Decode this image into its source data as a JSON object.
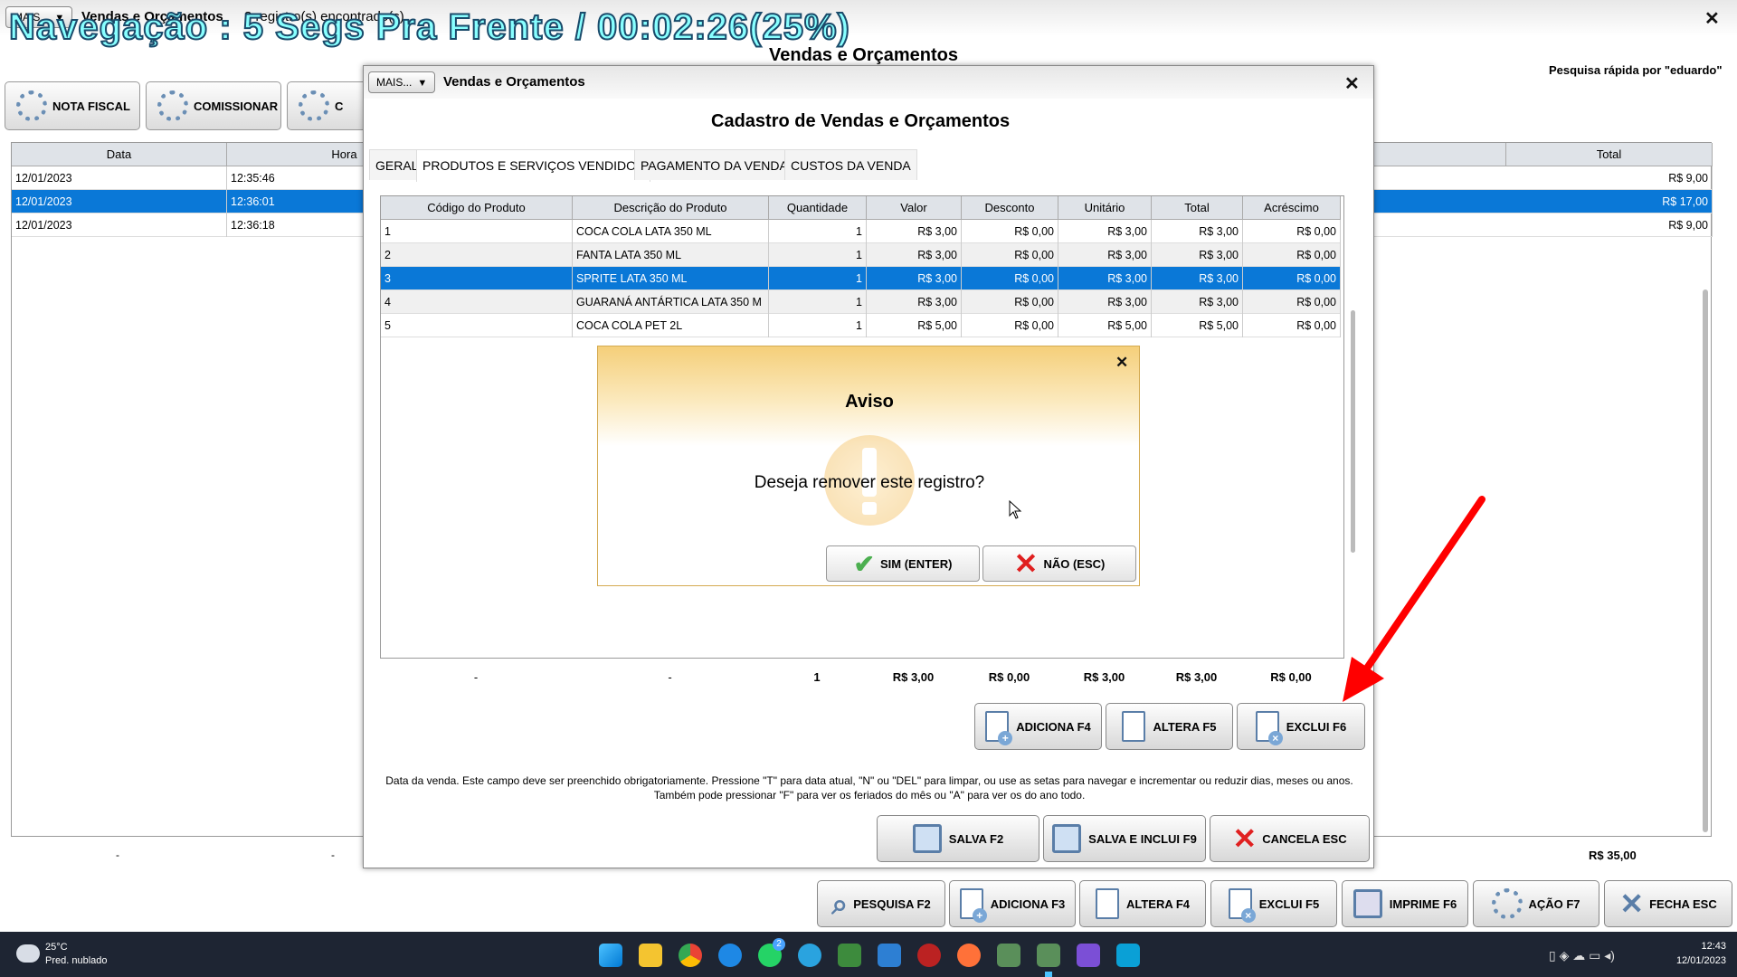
{
  "main": {
    "mais_label": "MAIS...",
    "title": "Vendas e Orçamentos",
    "record_count": "3 registro(s) encontrado(s)",
    "heading": "Vendas e Orçamentos",
    "quick_search": "Pesquisa rápida por \"eduardo\"",
    "toolbar": {
      "nota_fiscal": "NOTA FISCAL",
      "comissionar": "COMISSIONAR",
      "partial": "C"
    },
    "columns": {
      "data": "Data",
      "hora": "Hora",
      "total": "Total"
    },
    "rows": [
      {
        "data": "12/01/2023",
        "hora": "12:35:46",
        "total": "R$ 9,00"
      },
      {
        "data": "12/01/2023",
        "hora": "12:36:01",
        "total": "R$ 17,00"
      },
      {
        "data": "12/01/2023",
        "hora": "12:36:18",
        "total": "R$ 9,00"
      }
    ],
    "footer": {
      "data": "-",
      "hora": "-",
      "total": "R$ 35,00"
    },
    "buttons": {
      "pesquisa": "PESQUISA F2",
      "adiciona": "ADICIONA F3",
      "altera": "ALTERA F4",
      "exclui": "EXCLUI F5",
      "imprime": "IMPRIME F6",
      "acao": "AÇÃO F7",
      "fecha": "FECHA ESC"
    }
  },
  "overlay": {
    "text": "Navegação : 5 Segs Pra Frente / 00:02:26(25%)"
  },
  "dialog": {
    "mais_label": "MAIS...",
    "title": "Vendas e Orçamentos",
    "heading": "Cadastro de Vendas e Orçamentos",
    "tabs": [
      "GERAL",
      "PRODUTOS E SERVIÇOS VENDIDOS",
      "PAGAMENTO DA VENDA",
      "CUSTOS DA VENDA"
    ],
    "columns": [
      "Código do Produto",
      "Descrição do Produto",
      "Quantidade",
      "Valor",
      "Desconto",
      "Unitário",
      "Total",
      "Acréscimo"
    ],
    "rows": [
      [
        "1",
        "COCA COLA LATA 350 ML",
        "1",
        "R$ 3,00",
        "R$ 0,00",
        "R$ 3,00",
        "R$ 3,00",
        "R$ 0,00"
      ],
      [
        "2",
        "FANTA LATA 350 ML",
        "1",
        "R$ 3,00",
        "R$ 0,00",
        "R$ 3,00",
        "R$ 3,00",
        "R$ 0,00"
      ],
      [
        "3",
        "SPRITE LATA 350 ML",
        "1",
        "R$ 3,00",
        "R$ 0,00",
        "R$ 3,00",
        "R$ 3,00",
        "R$ 0,00"
      ],
      [
        "4",
        "GUARANÁ ANTÁRTICA LATA 350 M",
        "1",
        "R$ 3,00",
        "R$ 0,00",
        "R$ 3,00",
        "R$ 3,00",
        "R$ 0,00"
      ],
      [
        "5",
        "COCA COLA PET 2L",
        "1",
        "R$ 5,00",
        "R$ 0,00",
        "R$ 5,00",
        "R$ 5,00",
        "R$ 0,00"
      ]
    ],
    "footer": [
      "-",
      "-",
      "1",
      "R$ 3,00",
      "R$ 0,00",
      "R$ 3,00",
      "R$ 3,00",
      "R$ 0,00"
    ],
    "item_buttons": {
      "adiciona": "ADICIONA F4",
      "altera": "ALTERA F5",
      "exclui": "EXCLUI F6"
    },
    "help_text": "Data da venda. Este campo deve ser preenchido obrigatoriamente. Pressione \"T\" para data atual, \"N\" ou \"DEL\" para limpar, ou use as setas para navegar e incrementar ou reduzir dias, meses ou anos. Também pode pressionar \"F\" para ver os feriados do mês ou \"A\" para ver os do ano todo.",
    "buttons": {
      "salva": "SALVA F2",
      "salva_inclui": "SALVA E INCLUI F9",
      "cancela": "CANCELA ESC"
    }
  },
  "aviso": {
    "title": "Aviso",
    "message": "Deseja remover este registro?",
    "yes": "SIM (ENTER)",
    "no": "NÃO (ESC)"
  },
  "taskbar": {
    "weather_temp": "25°C",
    "weather_desc": "Pred. nublado",
    "whatsapp_badge": "2",
    "time": "12:43",
    "date": "12/01/2023"
  },
  "colors": {
    "selection": "#0a78d7",
    "annotation_arrow": "#ff0000",
    "aviso_header": "#f5cf7a"
  }
}
